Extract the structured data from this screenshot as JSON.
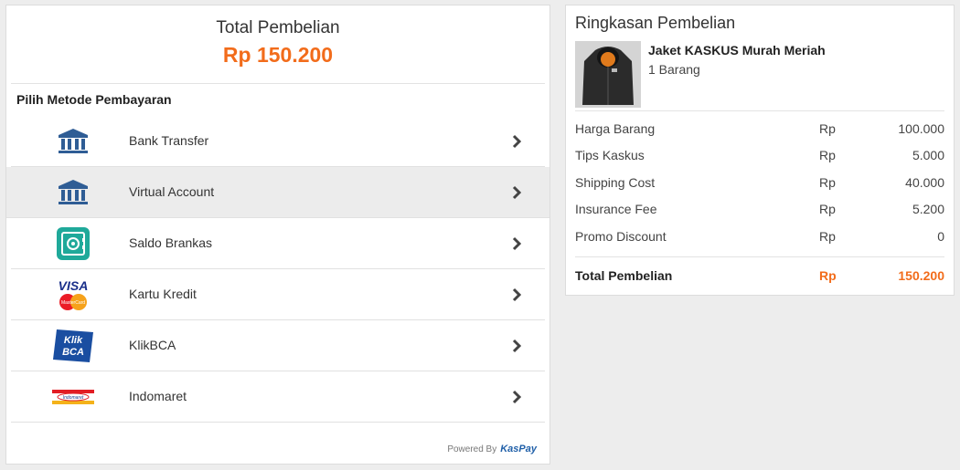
{
  "left": {
    "total_title": "Total Pembelian",
    "total_amount": "Rp 150.200",
    "method_heading": "Pilih Metode Pembayaran",
    "methods": [
      {
        "label": "Bank Transfer",
        "icon": "bank-icon"
      },
      {
        "label": "Virtual Account",
        "icon": "bank-icon"
      },
      {
        "label": "Saldo Brankas",
        "icon": "safe-icon"
      },
      {
        "label": "Kartu Kredit",
        "icon": "visa-mastercard-icon"
      },
      {
        "label": "KlikBCA",
        "icon": "klikbca-icon"
      },
      {
        "label": "Indomaret",
        "icon": "indomaret-icon"
      }
    ],
    "selected_method": "Virtual Account",
    "powered_by": "Powered By",
    "powered_brand": "KasPay"
  },
  "right": {
    "title": "Ringkasan Pembelian",
    "product": {
      "name": "Jaket KASKUS Murah Meriah",
      "qty": "1 Barang"
    },
    "rows": [
      {
        "label": "Harga Barang",
        "currency": "Rp",
        "value": "100.000"
      },
      {
        "label": "Tips Kaskus",
        "currency": "Rp",
        "value": "5.000"
      },
      {
        "label": "Shipping Cost",
        "currency": "Rp",
        "value": "40.000"
      },
      {
        "label": "Insurance Fee",
        "currency": "Rp",
        "value": "5.200"
      },
      {
        "label": "Promo Discount",
        "currency": "Rp",
        "value": "0"
      }
    ],
    "total": {
      "label": "Total Pembelian",
      "currency": "Rp",
      "value": "150.200"
    }
  },
  "colors": {
    "accent": "#f26c1b",
    "bank_blue": "#2f5d95",
    "safe_teal": "#1fa99a",
    "selected_bg": "#ececec"
  }
}
